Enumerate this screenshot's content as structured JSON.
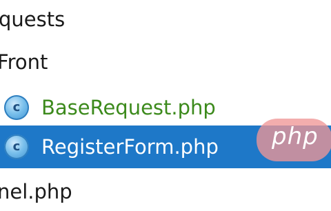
{
  "tree": {
    "items": [
      {
        "label": "quests",
        "type": "folder"
      },
      {
        "label": "Front",
        "type": "folder"
      },
      {
        "label": "BaseRequest.php",
        "type": "php-class-file",
        "color": "#3c8a1c",
        "icon": "class-c-icon",
        "icon_letter": "c"
      },
      {
        "label": "RegisterForm.php",
        "type": "php-class-file",
        "selected": true,
        "icon": "class-c-icon",
        "icon_letter": "c"
      },
      {
        "label": "nel.php",
        "type": "file"
      }
    ]
  },
  "colors": {
    "selection_background": "#1e78c8",
    "modified_file_text": "#3c8a1c"
  },
  "watermark": {
    "text": "php"
  }
}
